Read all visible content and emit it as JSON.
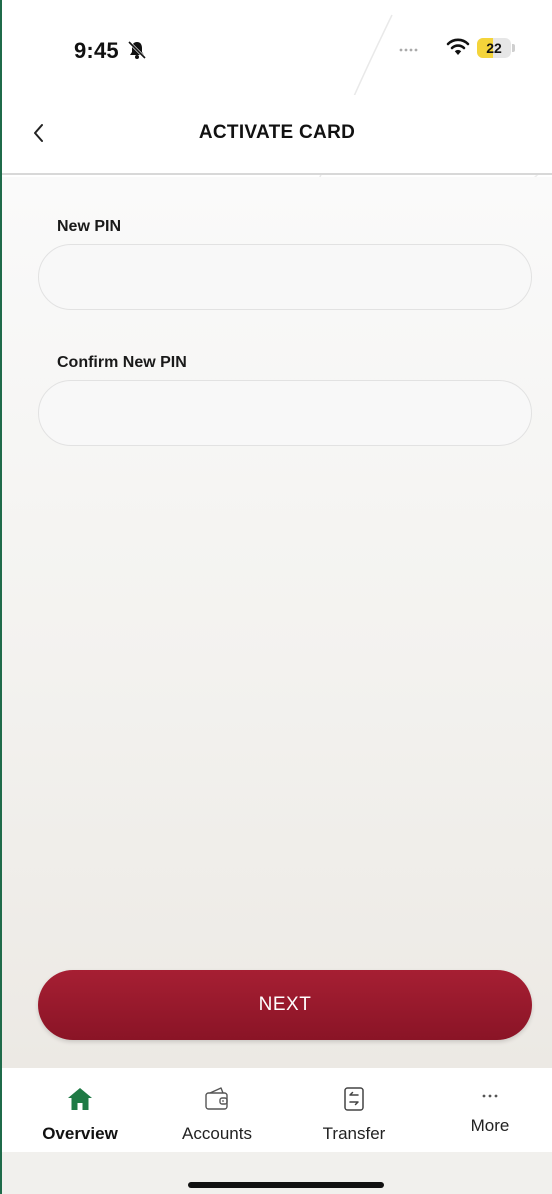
{
  "status_bar": {
    "time": "9:45",
    "battery_level": "22",
    "battery_fraction": 0.22,
    "icons": [
      "bell-slash-icon",
      "cellular-dots-icon",
      "wifi-icon",
      "battery-icon"
    ]
  },
  "header": {
    "title": "ACTIVATE CARD",
    "back_icon": "chevron-left-icon"
  },
  "form": {
    "new_pin": {
      "label": "New PIN",
      "value": "",
      "placeholder": ""
    },
    "confirm_pin": {
      "label": "Confirm New PIN",
      "value": "",
      "placeholder": ""
    },
    "submit_label": "NEXT"
  },
  "bottom_nav": {
    "items": [
      {
        "label": "Overview",
        "icon": "home-icon",
        "active": true
      },
      {
        "label": "Accounts",
        "icon": "wallet-icon",
        "active": false
      },
      {
        "label": "Transfer",
        "icon": "transfer-icon",
        "active": false
      },
      {
        "label": "More",
        "icon": "more-dots-icon",
        "active": false
      }
    ]
  },
  "colors": {
    "accent": "#1f6b4a",
    "primary_button": "#9a1a2e",
    "active_nav_icon": "#1f7a45"
  }
}
